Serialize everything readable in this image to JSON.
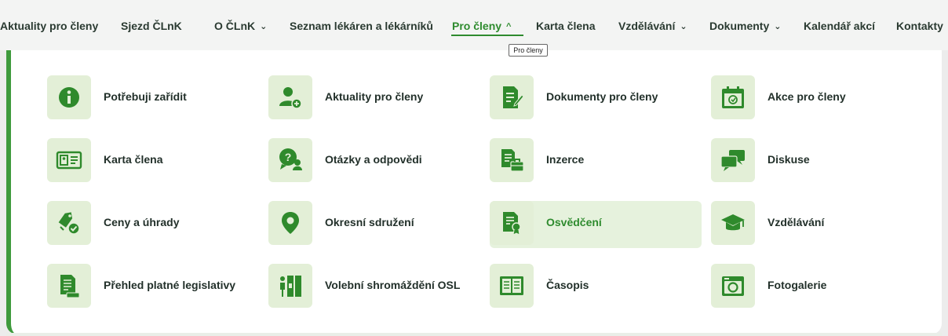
{
  "nav": {
    "items": [
      {
        "label": "Aktuality pro členy",
        "chevron": false,
        "active": false
      },
      {
        "label": "Sjezd ČLnK",
        "chevron": false,
        "active": false
      },
      {
        "label": "O ČLnK",
        "chevron": true,
        "active": false
      },
      {
        "label": "Seznam lékáren a lékárníků",
        "chevron": false,
        "active": false
      },
      {
        "label": "Pro členy",
        "chevron": true,
        "active": true
      },
      {
        "label": "Karta člena",
        "chevron": false,
        "active": false
      },
      {
        "label": "Vzdělávání",
        "chevron": true,
        "active": false
      },
      {
        "label": "Dokumenty",
        "chevron": true,
        "active": false
      },
      {
        "label": "Kalendář akcí",
        "chevron": false,
        "active": false
      },
      {
        "label": "Kontakty",
        "chevron": false,
        "active": false
      }
    ],
    "tooltip": "Pro členy",
    "chevron_down": "⌄",
    "chevron_up": "^"
  },
  "menu": {
    "items": [
      {
        "label": "Potřebuji zařídit",
        "icon": "info-icon"
      },
      {
        "label": "Aktuality pro členy",
        "icon": "user-add-icon"
      },
      {
        "label": "Dokumenty pro členy",
        "icon": "document-edit-icon"
      },
      {
        "label": "Akce pro členy",
        "icon": "calendar-icon"
      },
      {
        "label": "Karta člena",
        "icon": "id-card-icon"
      },
      {
        "label": "Otázky a odpovědi",
        "icon": "question-chat-icon"
      },
      {
        "label": "Inzerce",
        "icon": "document-briefcase-icon"
      },
      {
        "label": "Diskuse",
        "icon": "discussion-icon"
      },
      {
        "label": "Ceny a úhrady",
        "icon": "price-tag-icon"
      },
      {
        "label": "Okresní sdružení",
        "icon": "map-pin-icon"
      },
      {
        "label": "Osvědčení",
        "icon": "certificate-icon",
        "highlighted": true
      },
      {
        "label": "Vzdělávání",
        "icon": "graduation-cap-icon"
      },
      {
        "label": "Přehled platné legislativy",
        "icon": "legislation-icon"
      },
      {
        "label": "Volební shromáždění OSL",
        "icon": "voting-icon"
      },
      {
        "label": "Časopis",
        "icon": "magazine-icon"
      },
      {
        "label": "Fotogalerie",
        "icon": "camera-icon"
      }
    ]
  },
  "colors": {
    "accent": "#2e8b2e",
    "icon_green": "#2f8a2c",
    "tile_bg": "#e3efd7",
    "highlight_bg": "#e6f2dd"
  }
}
